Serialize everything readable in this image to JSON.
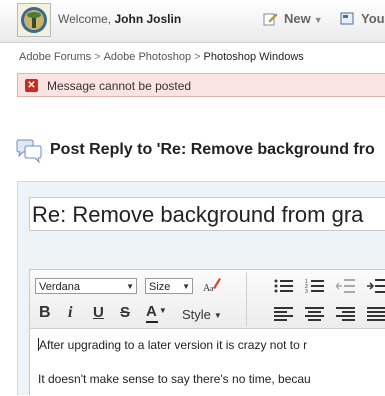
{
  "header": {
    "welcome_prefix": "Welcome,",
    "user_name": "John Joslin",
    "new_label": "New",
    "your_label": "Your"
  },
  "breadcrumb": {
    "items": [
      "Adobe Forums",
      "Adobe Photoshop",
      "Photoshop Windows"
    ],
    "separator": ">"
  },
  "error": {
    "message": "Message cannot be posted"
  },
  "reply": {
    "title": "Post Reply to 'Re: Remove background fro"
  },
  "editor": {
    "subject": "Re: Remove background from gra",
    "font_value": "Verdana",
    "size_value": "Size",
    "style_label": "Style",
    "content_lines": [
      "After upgrading to a later version it is crazy not to r",
      "It doesn't make sense to say there's no time, becau"
    ]
  },
  "colors": {
    "error_bg": "#fbe3e1",
    "error_icon": "#cc2a1f",
    "panel_bg": "#eef3f8"
  }
}
